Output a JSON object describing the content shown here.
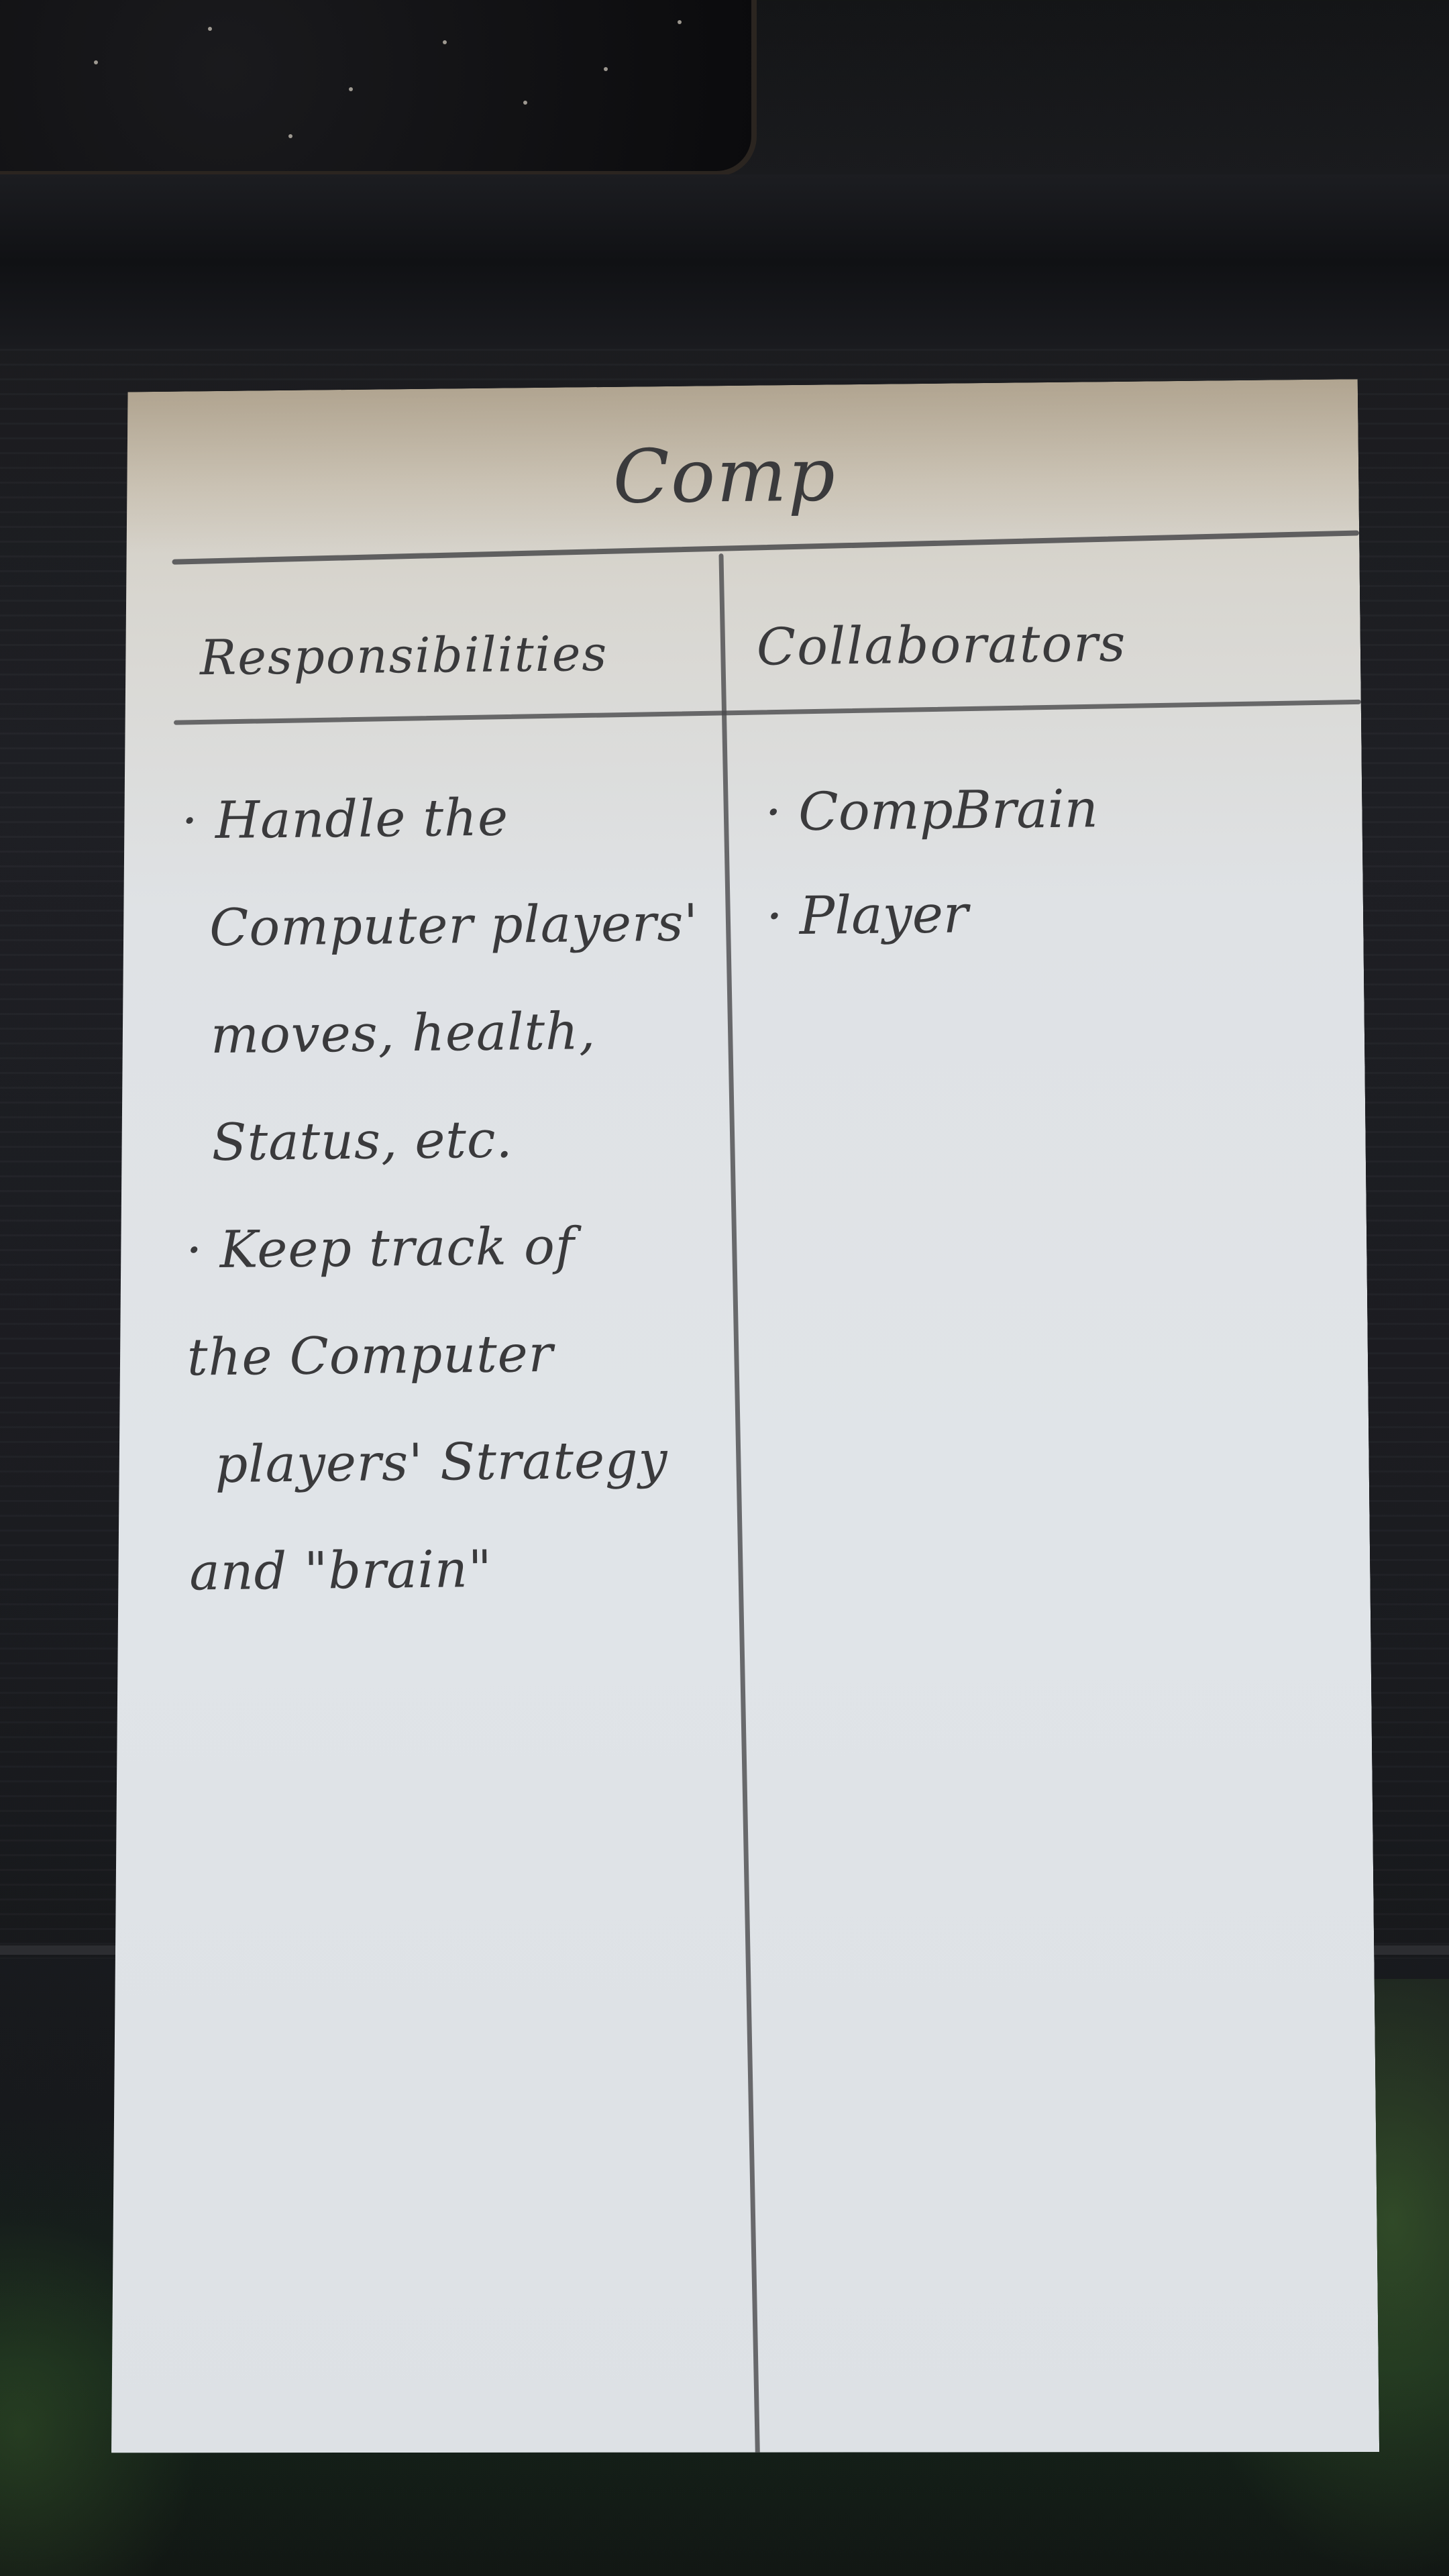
{
  "card": {
    "title": "Comp",
    "columns": {
      "left_heading": "Responsibilities",
      "right_heading": "Collaborators"
    },
    "responsibilities": [
      "· Handle the",
      "Computer players'",
      "moves, health,",
      "Status, etc.",
      "· Keep track of",
      "the Computer",
      "players' Strategy",
      "and \"brain\""
    ],
    "collaborators": [
      "· CompBrain",
      "· Player"
    ]
  },
  "colors": {
    "card_paper": "#e0e4e8",
    "pencil": "#3a3a3c",
    "background": "#1c1d22"
  }
}
